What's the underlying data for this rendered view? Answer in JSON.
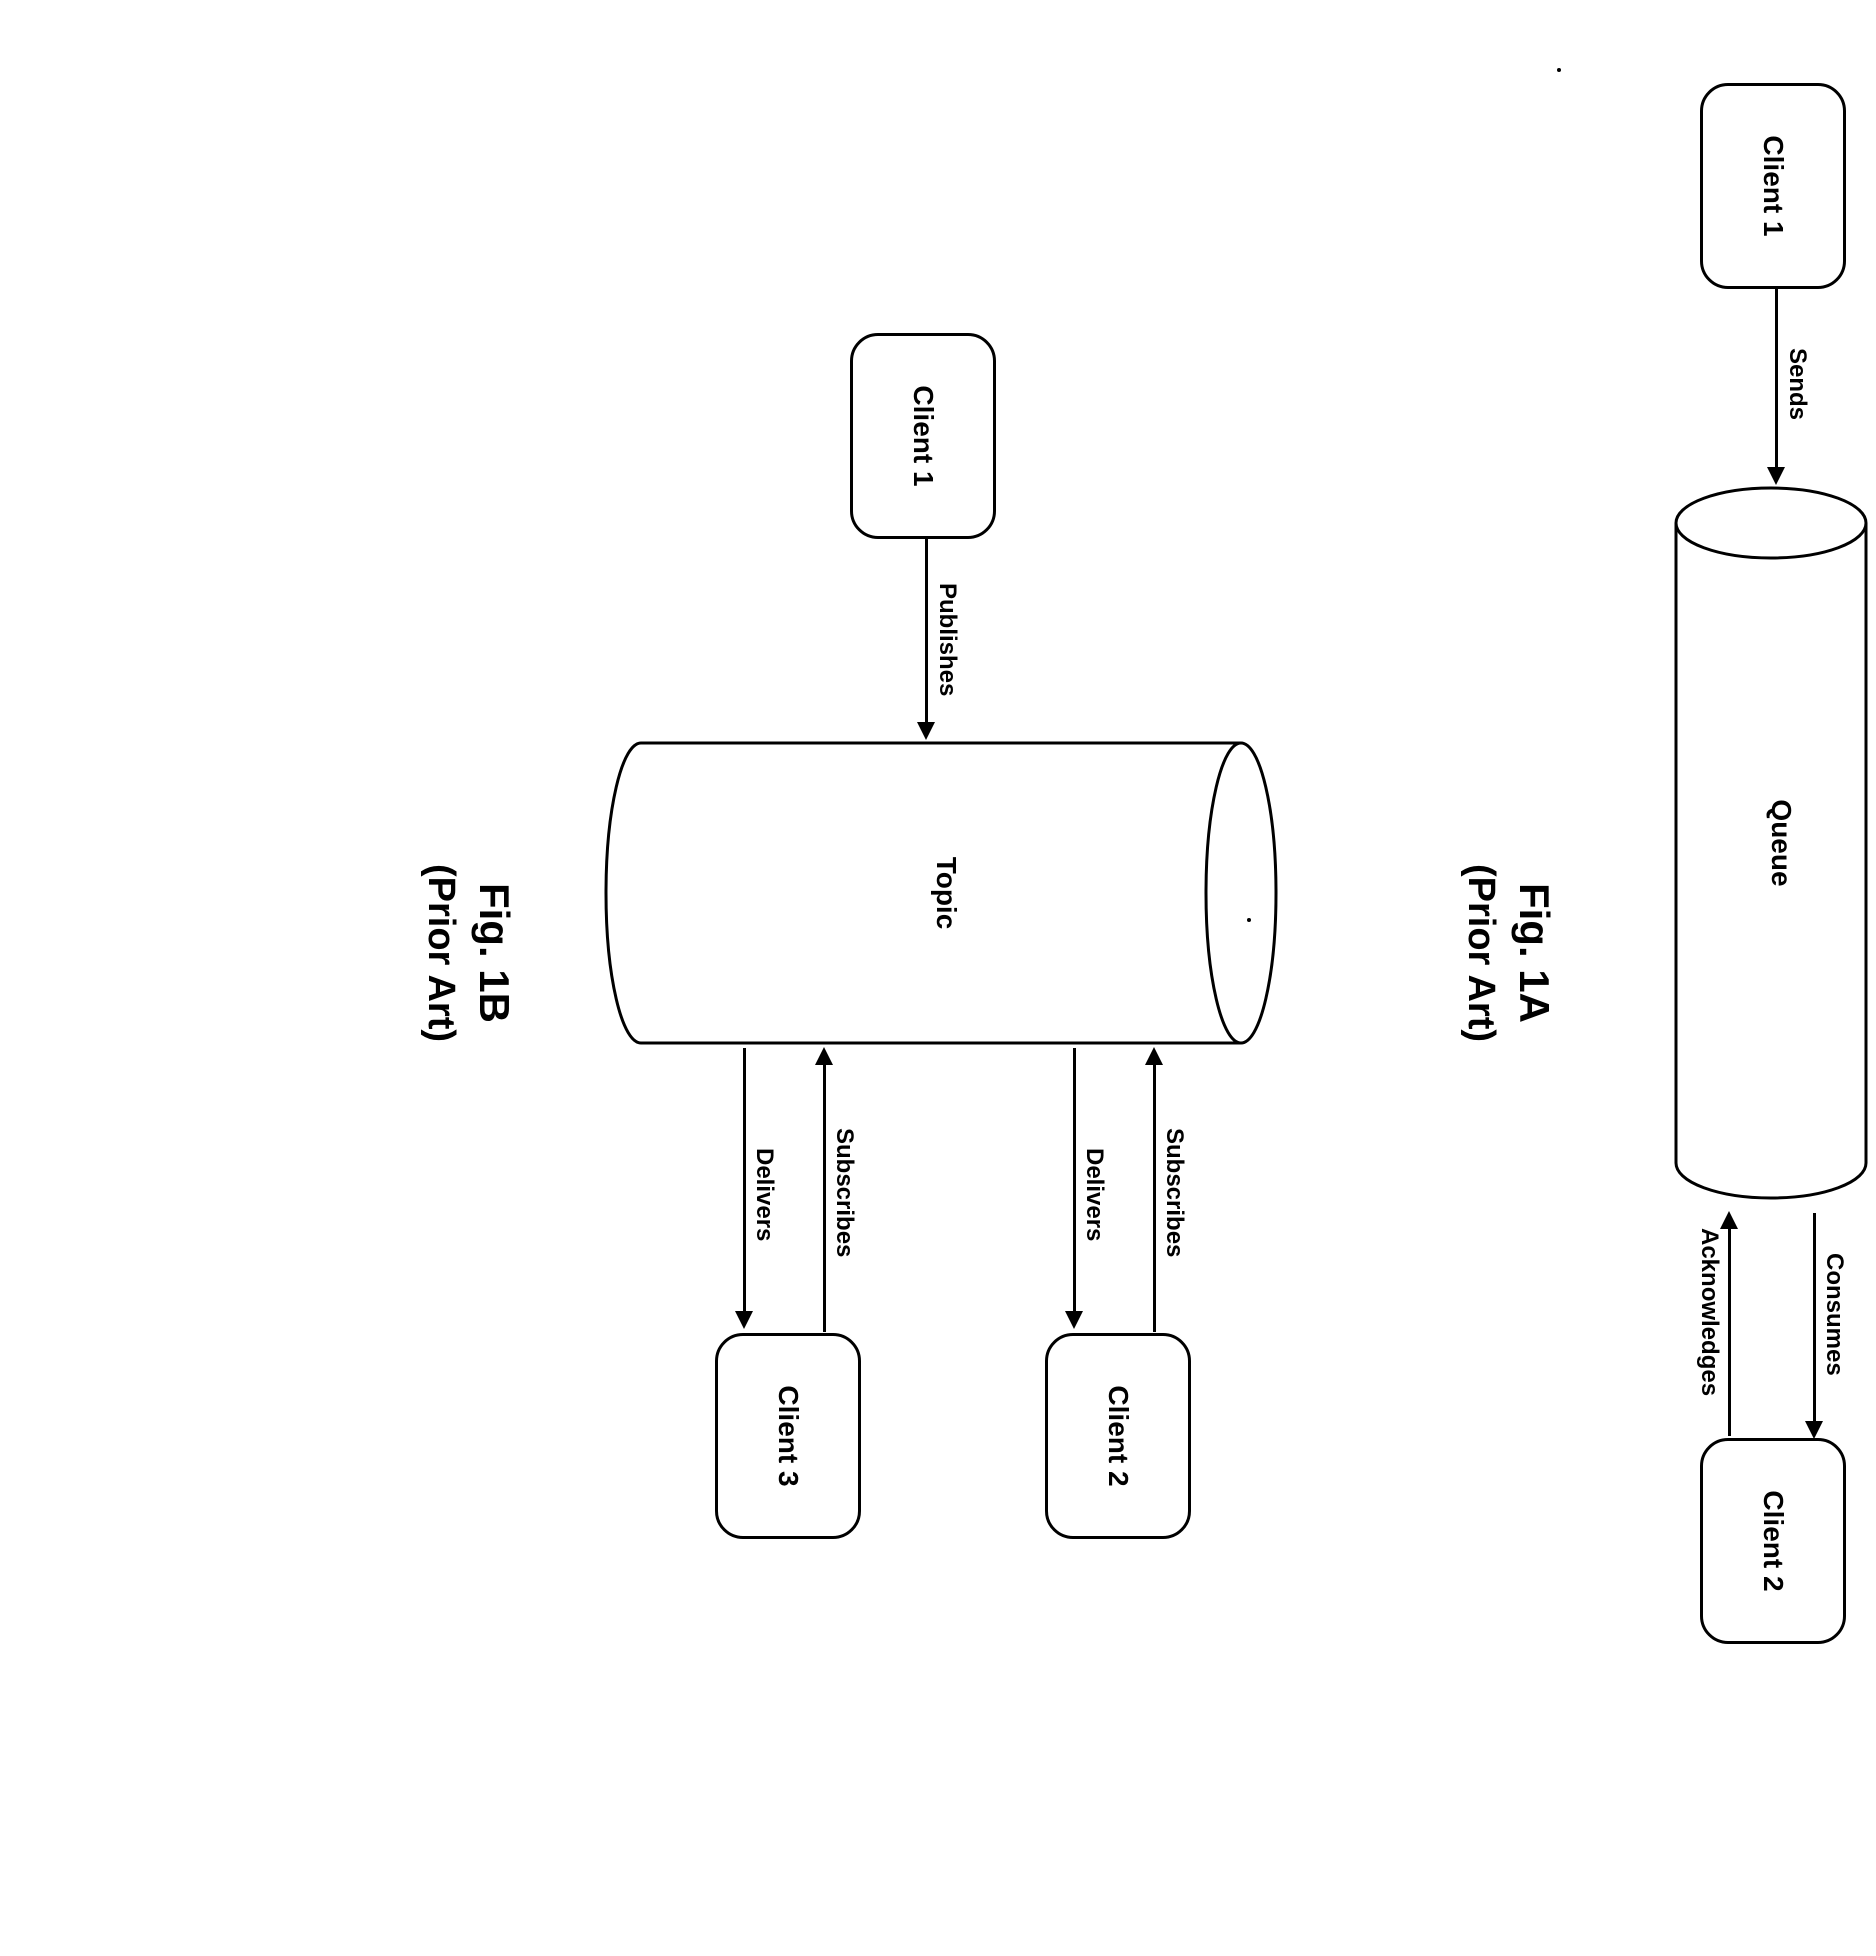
{
  "figA": {
    "client1": "Client 1",
    "client2": "Client 2",
    "cylinder": "Queue",
    "sends": "Sends",
    "consumes": "Consumes",
    "acknowledges": "Acknowledges",
    "title": "Fig. 1A",
    "subtitle": "(Prior Art)"
  },
  "figB": {
    "client1": "Client 1",
    "client2": "Client 2",
    "client3": "Client 3",
    "cylinder": "Topic",
    "publishes": "Publishes",
    "subscribes1": "Subscribes",
    "delivers1": "Delivers",
    "subscribes2": "Subscribes",
    "delivers2": "Delivers",
    "title": "Fig. 1B",
    "subtitle": "(Prior Art)"
  }
}
